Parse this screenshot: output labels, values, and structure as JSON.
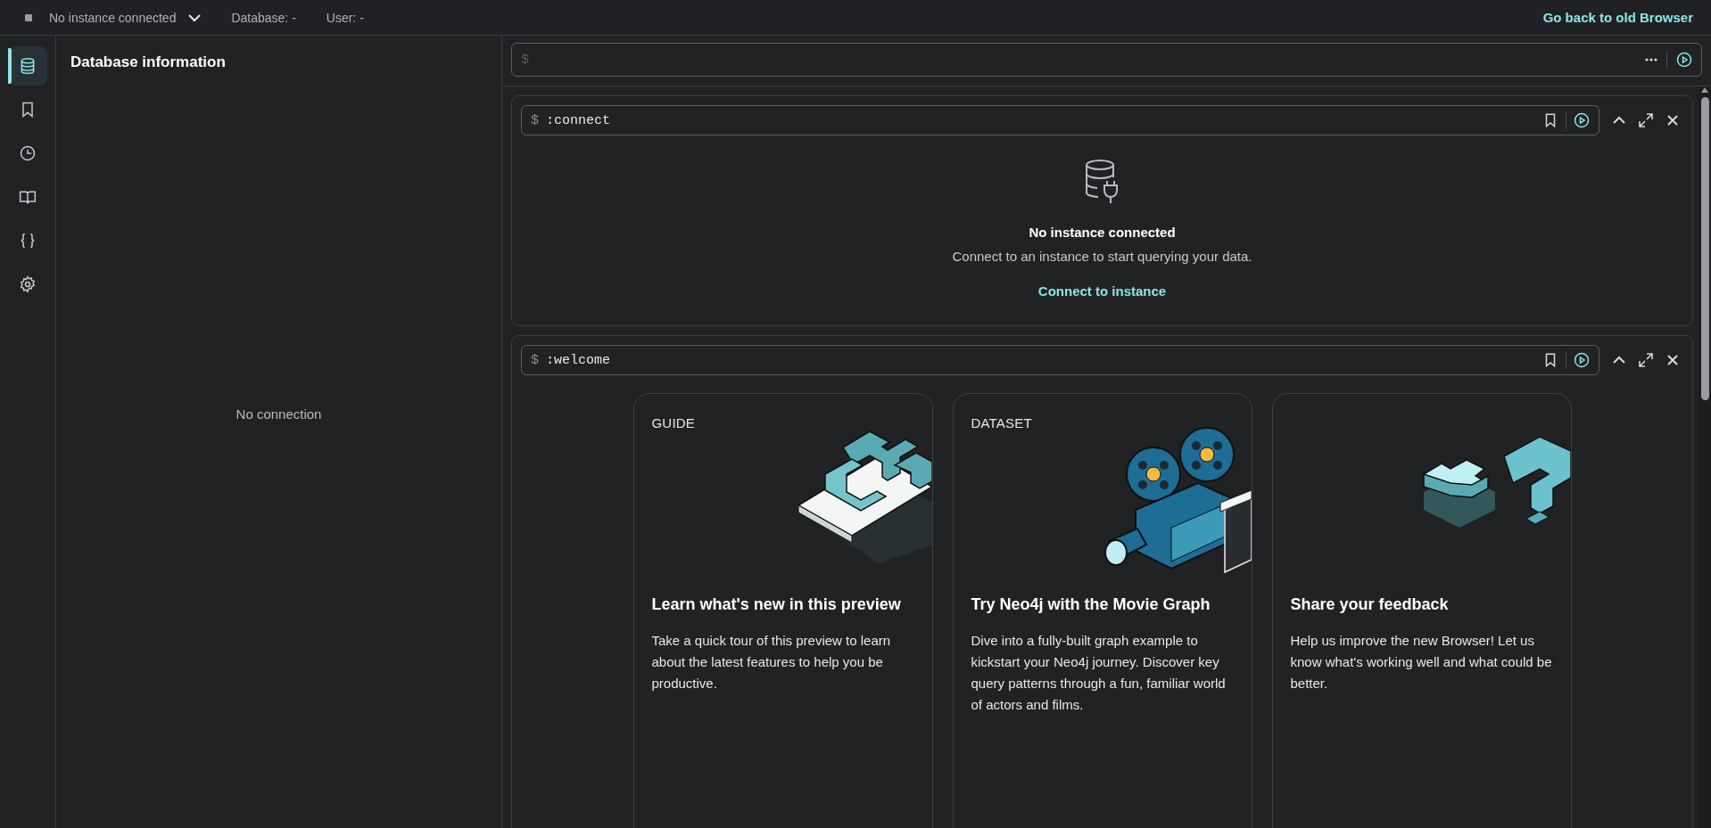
{
  "top_bar": {
    "connection_status": "No instance connected",
    "database_label": "Database: -",
    "user_label": "User: -",
    "old_browser_link": "Go back to old Browser"
  },
  "sidebar": {
    "items": [
      {
        "kind": "database",
        "selected": true
      },
      {
        "kind": "bookmark",
        "selected": false
      },
      {
        "kind": "history",
        "selected": false
      },
      {
        "kind": "guides",
        "selected": false
      },
      {
        "kind": "parameters",
        "selected": false
      },
      {
        "kind": "settings",
        "selected": false
      }
    ]
  },
  "database_panel": {
    "title": "Database information",
    "empty_message": "No connection"
  },
  "editor": {
    "prompt": "$"
  },
  "frames": [
    {
      "kind": "connect",
      "prompt": "$",
      "command": ":connect",
      "title": "No instance connected",
      "message": "Connect to an instance to start querying your data.",
      "link": "Connect to instance"
    },
    {
      "kind": "welcome",
      "prompt": "$",
      "command": ":welcome",
      "cards": [
        {
          "kind": "guide",
          "label": "GUIDE",
          "title": "Learn what's new in this preview",
          "description": "Take a quick tour of this preview to learn about the latest features to help you be productive."
        },
        {
          "kind": "dataset",
          "label": "DATASET",
          "title": "Try Neo4j with the Movie Graph",
          "description": "Dive into a fully-built graph example to kickstart your Neo4j journey. Discover key query patterns through a fun, familiar world of actors and films."
        },
        {
          "kind": "feedback",
          "title": "Share your feedback",
          "description": "Help us improve the new Browser! Let us know what's working well and what could be better."
        }
      ]
    }
  ]
}
